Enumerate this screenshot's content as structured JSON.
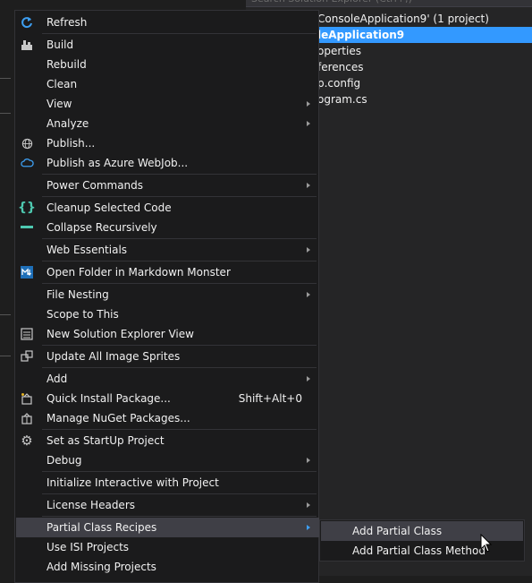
{
  "solution_explorer": {
    "search_placeholder": "Search Solution Explorer (Ctrl+;)",
    "items": [
      {
        "label": "ConsoleApplication9' (1 project)",
        "selected": false
      },
      {
        "label": "leApplication9",
        "selected": true
      },
      {
        "label": "operties",
        "selected": false
      },
      {
        "label": "ferences",
        "selected": false
      },
      {
        "label": "p.config",
        "selected": false
      },
      {
        "label": "ogram.cs",
        "selected": false
      }
    ]
  },
  "context_menu": {
    "items": [
      {
        "label": "Refresh",
        "icon": "refresh-icon"
      },
      {
        "label": "Build",
        "icon": "build-icon"
      },
      {
        "label": "Rebuild"
      },
      {
        "label": "Clean"
      },
      {
        "label": "View",
        "submenu": true
      },
      {
        "label": "Analyze",
        "submenu": true
      },
      {
        "label": "Publish...",
        "icon": "globe-icon"
      },
      {
        "label": "Publish as Azure WebJob...",
        "icon": "cloud-icon"
      },
      {
        "label": "Power Commands",
        "submenu": true
      },
      {
        "label": "Cleanup Selected Code",
        "icon": "braces-icon"
      },
      {
        "label": "Collapse Recursively",
        "icon": "collapse-icon"
      },
      {
        "label": "Web Essentials",
        "submenu": true
      },
      {
        "label": "Open Folder in Markdown Monster",
        "icon": "markdown-icon"
      },
      {
        "label": "File Nesting",
        "submenu": true
      },
      {
        "label": "Scope to This"
      },
      {
        "label": "New Solution Explorer View",
        "icon": "new-view-icon"
      },
      {
        "label": "Update All Image Sprites",
        "icon": "sprites-icon"
      },
      {
        "label": "Add",
        "submenu": true
      },
      {
        "label": "Quick Install Package...",
        "icon": "package-icon",
        "shortcut": "Shift+Alt+0"
      },
      {
        "label": "Manage NuGet Packages...",
        "icon": "nuget-icon"
      },
      {
        "label": "Set as StartUp Project",
        "icon": "gear-icon"
      },
      {
        "label": "Debug",
        "submenu": true
      },
      {
        "label": "Initialize Interactive with Project"
      },
      {
        "label": "License Headers",
        "submenu": true
      },
      {
        "label": "Partial Class Recipes",
        "submenu": true,
        "highlighted": true
      },
      {
        "label": "Use ISI Projects"
      },
      {
        "label": "Add Missing Projects"
      }
    ]
  },
  "submenu": {
    "items": [
      {
        "label": "Add Partial Class",
        "highlighted": true
      },
      {
        "label": "Add Partial Class Method"
      }
    ]
  },
  "colors": {
    "menu_bg": "#1b1b1c",
    "highlight": "#3f3f46",
    "selection": "#3399ff",
    "accent_icon": "#4ec9b0"
  }
}
